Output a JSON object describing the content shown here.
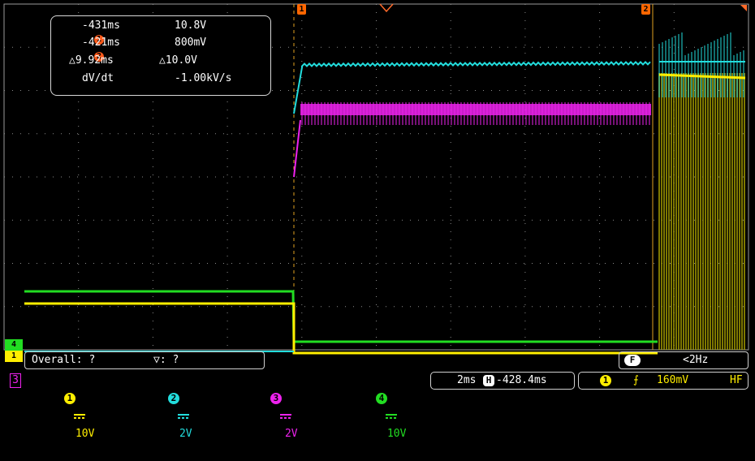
{
  "colors": {
    "ch1": "#ffee00",
    "ch2": "#22dddd",
    "ch3": "#ee22ee",
    "ch4": "#22dd22",
    "cursor": "#ff6600",
    "grid": "#8a8a8a"
  },
  "cursor_markers": {
    "c1": "1",
    "c2": "2"
  },
  "readout": {
    "c1_badge": "1",
    "c1_time": "-431ms",
    "c1_value": "10.8V",
    "c2_badge": "2",
    "c2_time": "-421ms",
    "c2_value": "800mV",
    "delta_t": "△9.92ms",
    "delta_v": "△10.0V",
    "dvdt_label": "dV/dt",
    "dvdt_value": "-1.00kV/s"
  },
  "level_tabs": {
    "ch4": "4",
    "ch1": "1"
  },
  "measure": {
    "label": "Overall: ?",
    "sub": "▽: ?"
  },
  "freq": {
    "icon": "F",
    "value": "<2Hz"
  },
  "bottom": {
    "page": "3",
    "ch1_num": "1",
    "ch1_scale": "10V",
    "ch2_num": "2",
    "ch2_scale": "2V",
    "ch3_num": "3",
    "ch3_scale": "2V",
    "ch4_num": "4",
    "ch4_scale": "10V",
    "timebase": "2ms",
    "h_icon": "H",
    "h_offset": "-428.4ms",
    "trig_src": "1",
    "trig_edge": "⨍",
    "trig_level": "160mV",
    "trig_coupling": "HF"
  }
}
